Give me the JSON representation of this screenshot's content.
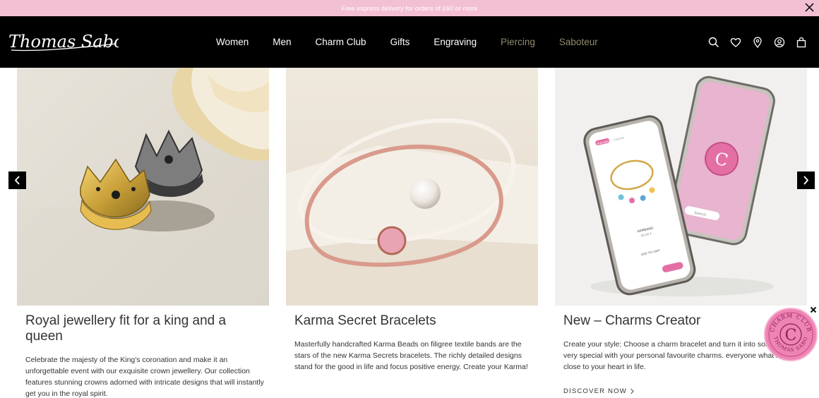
{
  "promo": {
    "text": "Free express delivery for orders of £60 or more"
  },
  "header": {
    "logo_text": "Thomas Sabo",
    "nav": [
      {
        "label": "Women"
      },
      {
        "label": "Men"
      },
      {
        "label": "Charm Club"
      },
      {
        "label": "Gifts"
      },
      {
        "label": "Engraving"
      },
      {
        "label": "Piercing"
      },
      {
        "label": "Saboteur"
      }
    ],
    "icons": [
      "search-icon",
      "heart-icon",
      "location-pin-icon",
      "account-icon",
      "shopping-bag-icon"
    ]
  },
  "cards": [
    {
      "title": "Royal jewellery fit for a king and a queen",
      "text": "Celebrate the majesty of the King's coronation and make it an unforgettable event with our exquisite crown jewellery. Our collection features stunning crowns adorned with intricate designs that will instantly get you in the royal spirit."
    },
    {
      "title": "Karma Secret Bracelets",
      "text": "Masterfully handcrafted Karma Beads on filigree textile bands are the stars of the new Karma Secrets bracelets. The richly detailed designs stand for the good in life and focus positive energy. Create your Karma!"
    },
    {
      "title": "New – Charms Creator",
      "text": "Create your style: Choose a charm bracelet and turn it into something very special with your personal favourite charms. everyone what's close to your heart in life.",
      "cta": "DISCOVER NOW"
    }
  ],
  "phone_screen": {
    "tag1": "Bracelets",
    "tag2": "Charms",
    "product": "ARMBAND",
    "price": "89,00 €",
    "action": "ADD TO CART",
    "search": "Search"
  },
  "charm_club_badge": {
    "arc_text": "CHARM CLUB",
    "arc_text_bottom": "THOMAS SABO",
    "letter": "C"
  },
  "colors": {
    "promo_bg": "#f3bfd3",
    "header_bg": "#000000",
    "nav_muted": "#8f8a6c",
    "badge_pink": "#ee84b4"
  }
}
